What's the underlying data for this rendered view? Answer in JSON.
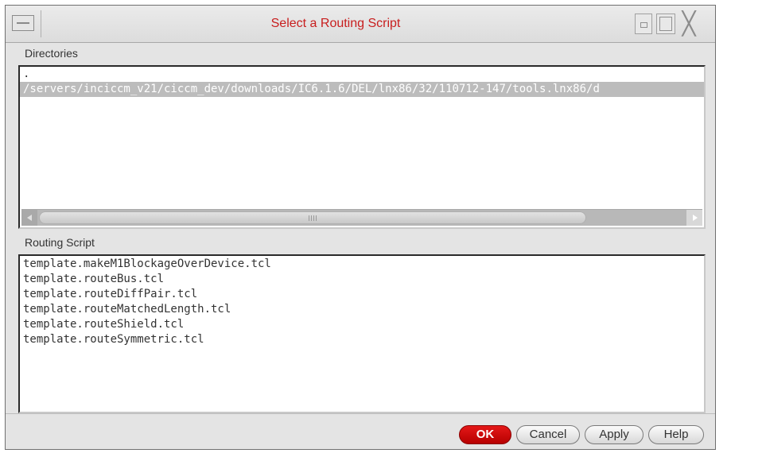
{
  "window": {
    "title": "Select a Routing Script"
  },
  "directories": {
    "label": "Directories",
    "items": [
      ".",
      "/servers/inciccm_v21/ciccm_dev/downloads/IC6.1.6/DEL/lnx86/32/110712-147/tools.lnx86/d"
    ],
    "selected_index": 1
  },
  "routing_script": {
    "label": "Routing Script",
    "items": [
      "template.makeM1BlockageOverDevice.tcl",
      "template.routeBus.tcl",
      "template.routeDiffPair.tcl",
      "template.routeMatchedLength.tcl",
      "template.routeShield.tcl",
      "template.routeSymmetric.tcl"
    ]
  },
  "buttons": {
    "ok": "OK",
    "cancel": "Cancel",
    "apply": "Apply",
    "help": "Help"
  },
  "colors": {
    "title": "#c81e1e",
    "ok_button": "#d00000",
    "selection": "#bcbcbc"
  },
  "icons": {
    "window_menu": "window-menu-icon",
    "minimize": "minimize-icon",
    "maximize": "maximize-icon",
    "close": "close-icon"
  }
}
